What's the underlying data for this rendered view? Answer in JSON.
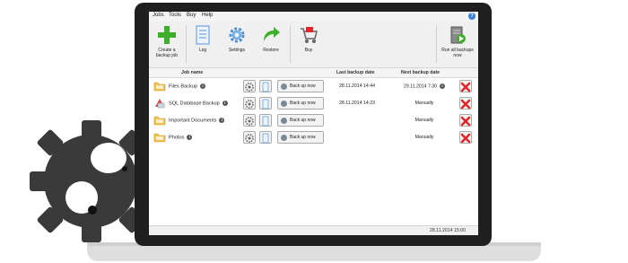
{
  "menu": {
    "items": [
      {
        "label": "Jobs"
      },
      {
        "label": "Tools"
      },
      {
        "label": "Buy"
      },
      {
        "label": "Help"
      }
    ]
  },
  "toolbar": {
    "create_label": "Create a backup job",
    "log_label": "Log",
    "settings_label": "Settings",
    "restore_label": "Restore",
    "buy_label": "Buy",
    "run_all_label": "Run all backups now"
  },
  "table": {
    "columns": {
      "job_name": "Job name",
      "last_backup": "Last backup date",
      "next_backup": "Next backup date"
    },
    "rows": [
      {
        "name": "Files Backup",
        "icon": "folder-icon",
        "button": "Back up now",
        "last": "28.11.2014 14:44",
        "next": "29.11.2014 7:30"
      },
      {
        "name": "SQL Database Backup",
        "icon": "sql-icon",
        "button": "Back up now",
        "last": "28.11.2014 14:23",
        "next": "Manually"
      },
      {
        "name": "Important Documents",
        "icon": "folder-icon",
        "button": "Back up now",
        "last": "",
        "next": "Manually"
      },
      {
        "name": "Photos",
        "icon": "folder-icon",
        "button": "Back up now",
        "last": "",
        "next": "Manually"
      }
    ]
  },
  "status": {
    "datetime": "28.11.2014 15:00"
  },
  "colors": {
    "accent_blue": "#3a7fd5",
    "delete_red": "#e0262a",
    "create_green": "#3fae2a",
    "laptop_frame": "#1f1f1f",
    "gear_dark": "#3a3a3a"
  }
}
